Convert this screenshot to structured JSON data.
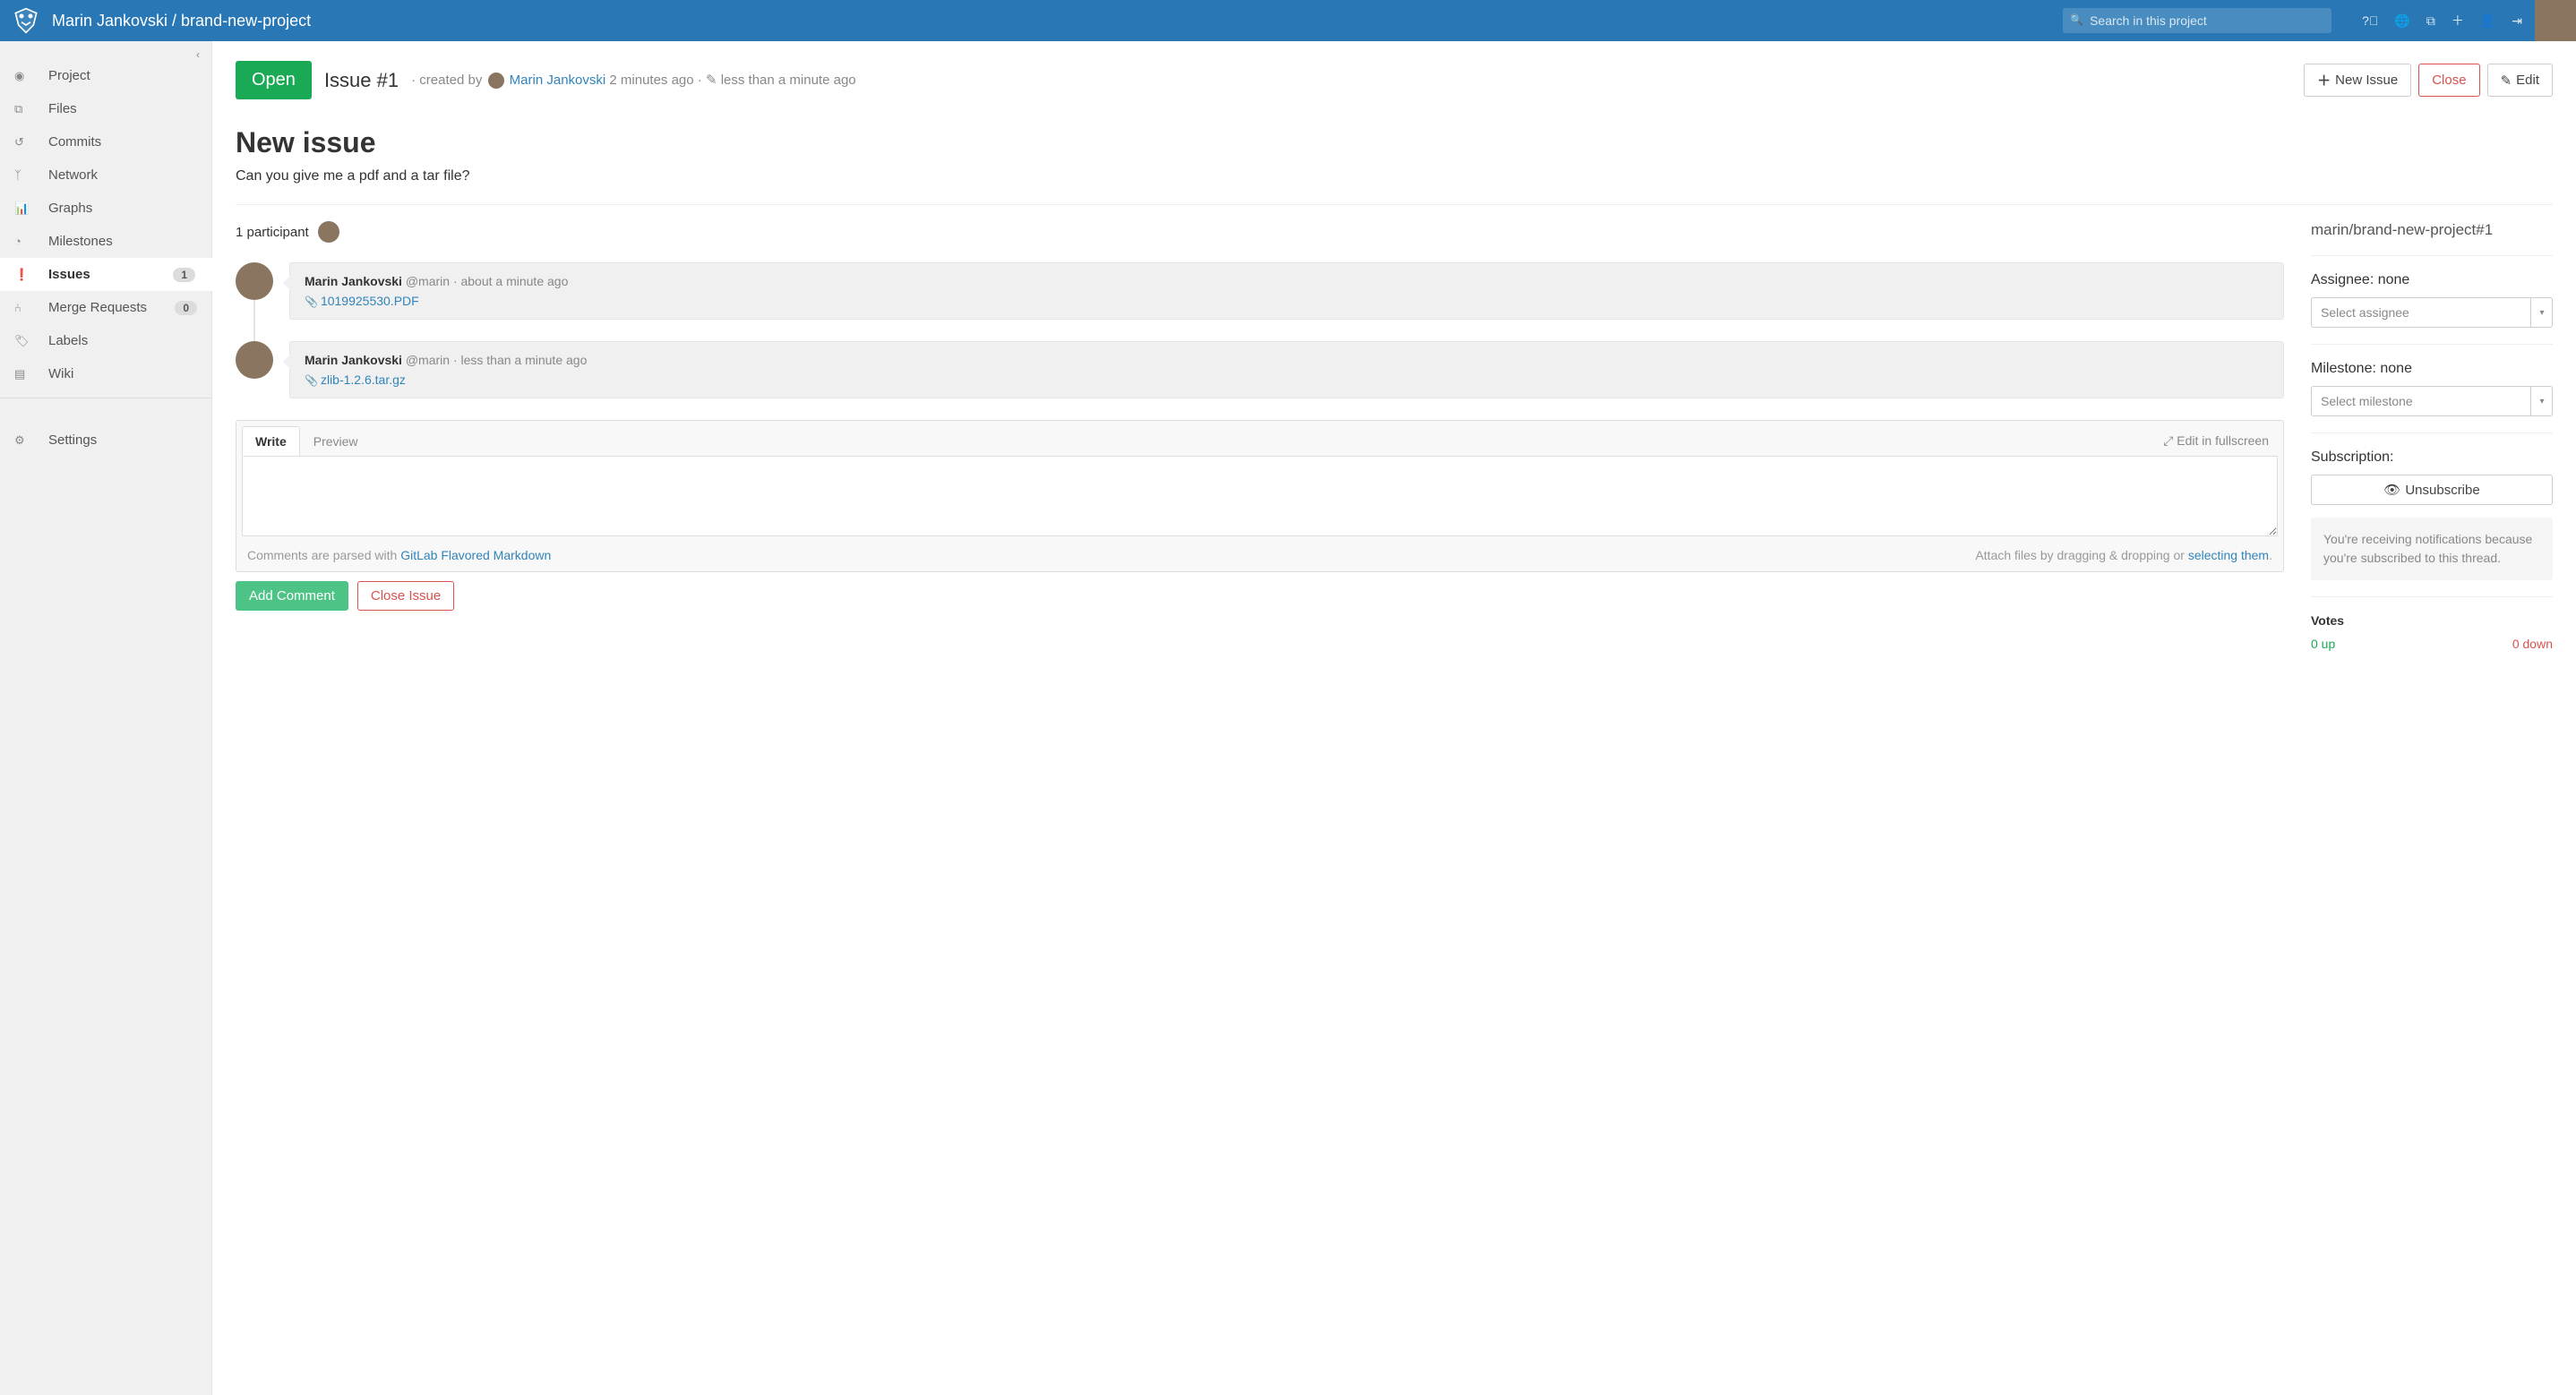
{
  "header": {
    "breadcrumb": "Marin Jankovski / brand-new-project",
    "search_placeholder": "Search in this project"
  },
  "sidebar": {
    "items": [
      {
        "icon": "dashboard-icon",
        "label": "Project"
      },
      {
        "icon": "files-icon",
        "label": "Files"
      },
      {
        "icon": "history-icon",
        "label": "Commits"
      },
      {
        "icon": "fork-icon",
        "label": "Network"
      },
      {
        "icon": "chart-icon",
        "label": "Graphs"
      },
      {
        "icon": "clock-icon",
        "label": "Milestones"
      },
      {
        "icon": "exclamation-icon",
        "label": "Issues",
        "badge": "1",
        "active": true
      },
      {
        "icon": "merge-icon",
        "label": "Merge Requests",
        "badge": "0"
      },
      {
        "icon": "tags-icon",
        "label": "Labels"
      },
      {
        "icon": "book-icon",
        "label": "Wiki"
      }
    ],
    "settings_label": "Settings"
  },
  "issue": {
    "status": "Open",
    "id": "Issue #1",
    "created_by_prefix": "· created by",
    "author": "Marin Jankovski",
    "created_time": "2 minutes ago",
    "edited_time": "· ✎ less than a minute ago",
    "new_issue_btn": "New Issue",
    "close_btn": "Close",
    "edit_btn": "Edit",
    "title": "New issue",
    "description": "Can you give me a pdf and a tar file?"
  },
  "participants": {
    "label": "1 participant"
  },
  "notes": [
    {
      "author": "Marin Jankovski",
      "handle": "@marin",
      "time": "· about a minute ago",
      "attachment": "1019925530.PDF"
    },
    {
      "author": "Marin Jankovski",
      "handle": "@marin",
      "time": "· less than a minute ago",
      "attachment": "zlib-1.2.6.tar.gz"
    }
  ],
  "comment": {
    "write_tab": "Write",
    "preview_tab": "Preview",
    "fullscreen": "Edit in fullscreen",
    "hint_prefix": "Comments are parsed with ",
    "hint_link": "GitLab Flavored Markdown",
    "attach_prefix": "Attach files by dragging & dropping or ",
    "attach_link": "selecting them",
    "attach_suffix": ".",
    "add_btn": "Add Comment",
    "close_btn": "Close Issue"
  },
  "sidepanel": {
    "ref": "marin/brand-new-project#1",
    "assignee_label": "Assignee:",
    "assignee_value": "none",
    "assignee_placeholder": "Select assignee",
    "milestone_label": "Milestone:",
    "milestone_value": "none",
    "milestone_placeholder": "Select milestone",
    "subscription_label": "Subscription:",
    "unsubscribe_btn": "Unsubscribe",
    "notice": "You're receiving notifications because you're subscribed to this thread.",
    "votes_label": "Votes",
    "votes_up": "0 up",
    "votes_down": "0 down"
  }
}
